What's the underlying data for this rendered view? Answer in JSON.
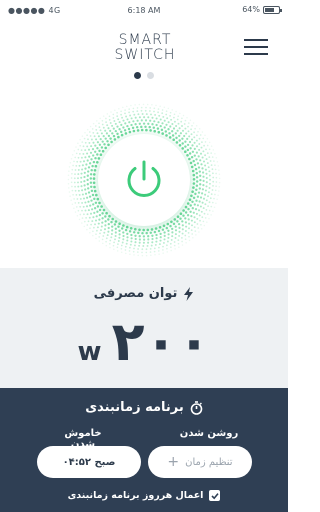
{
  "status_bar": {
    "signal": "●●●●● 4G",
    "time": "6:18 AM",
    "battery": "64%"
  },
  "header": {
    "logo_line1": "SMART",
    "logo_line2": "SWITCH",
    "menu_icon": "hamburger-menu-icon"
  },
  "pager": {
    "count": 2,
    "active": 1
  },
  "power": {
    "state": "on",
    "accent_color": "#3ccb7a",
    "icon": "power-icon"
  },
  "usage": {
    "title": "توان مصرفی",
    "icon": "lightning-icon",
    "value": "۲۰۰",
    "unit": "w"
  },
  "schedule": {
    "title": "برنامه زمانبندی",
    "icon": "stopwatch-icon",
    "on_label": "روشن شدن",
    "off_label": "خاموش شدن",
    "on_placeholder": "تنظیم زمان",
    "off_value": "۰۴:۵۲ صبح",
    "repeat_label": "اعمال هرروز برنامه زمانبندی",
    "repeat_checked": true
  },
  "colors": {
    "navy": "#2f3f54",
    "usage_bg": "#eef1f3",
    "green": "#3ccb7a"
  }
}
